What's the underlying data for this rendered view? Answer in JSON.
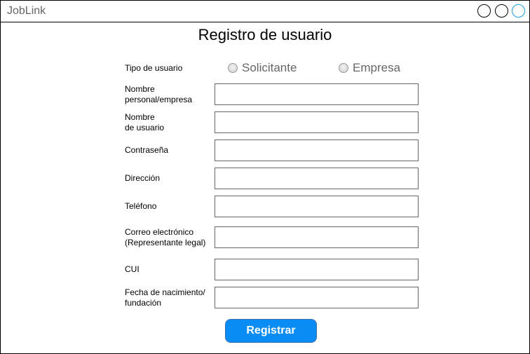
{
  "app": {
    "title": "JobLink"
  },
  "form": {
    "title": "Registro de usuario",
    "user_type": {
      "label": "Tipo de usuario",
      "options": [
        "Solicitante",
        "Empresa"
      ]
    },
    "fields": {
      "nombre": {
        "line1": "Nombre",
        "line2": "personal/empresa",
        "value": ""
      },
      "usuario": {
        "line1": "Nombre",
        "line2": "de usuario",
        "value": ""
      },
      "contrasena": {
        "label": "Contraseña",
        "value": ""
      },
      "direccion": {
        "label": "Dirección",
        "value": ""
      },
      "telefono": {
        "label": "Teléfono",
        "value": ""
      },
      "correo": {
        "line1": "Correo electrónico",
        "line2": "(Representante legal)",
        "value": ""
      },
      "cui": {
        "label": "CUI",
        "value": ""
      },
      "fecha": {
        "line1": "Fecha de nacimiento/",
        "line2": "fundación",
        "value": ""
      }
    },
    "submit_label": "Registrar"
  }
}
